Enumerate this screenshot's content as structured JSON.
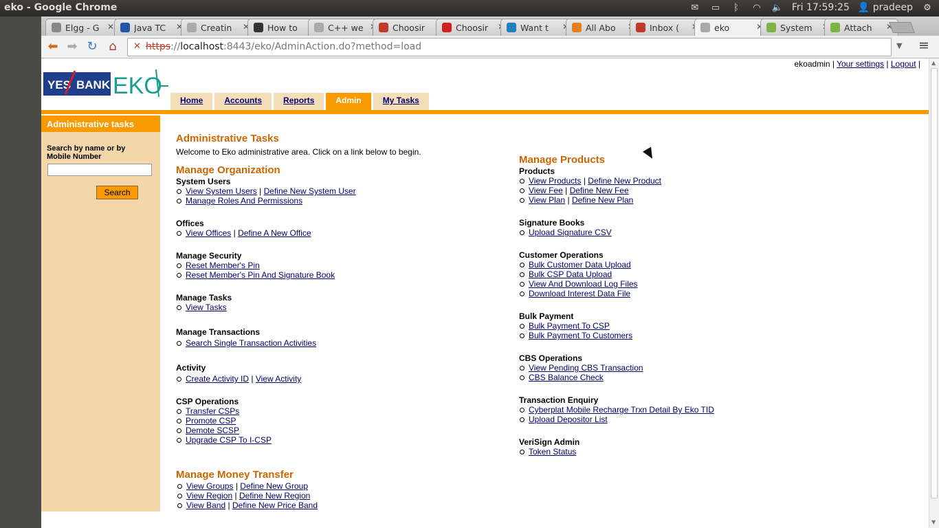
{
  "os": {
    "window_title": "eko - Google Chrome",
    "time": "Fri 17:59:25",
    "user": "pradeep"
  },
  "tabs": [
    {
      "label": "Elgg - G",
      "icon": "google-icon",
      "color": "#888888"
    },
    {
      "label": "Java TC",
      "icon": "grid-icon",
      "color": "#2255aa"
    },
    {
      "label": "Creatin",
      "icon": "page-icon",
      "color": "#aaaaaa"
    },
    {
      "label": "How to",
      "icon": "wordpress-icon",
      "color": "#333333"
    },
    {
      "label": "C++ we",
      "icon": "page-icon",
      "color": "#aaaaaa"
    },
    {
      "label": "Choosir",
      "icon": "sv-icon",
      "color": "#c0392b"
    },
    {
      "label": "Choosir",
      "icon": "red-circle-icon",
      "color": "#d41f1f"
    },
    {
      "label": "Want t",
      "icon": "drupal-icon",
      "color": "#1f7fc0"
    },
    {
      "label": "All Abo",
      "icon": "asterisk-icon",
      "color": "#e67e22"
    },
    {
      "label": "Inbox (",
      "icon": "gmail-icon",
      "color": "#c0392b"
    },
    {
      "label": "eko",
      "icon": "page-icon",
      "color": "#aaaaaa"
    },
    {
      "label": "System",
      "icon": "leaf-icon",
      "color": "#7cb342"
    },
    {
      "label": "Attach",
      "icon": "leaf-icon",
      "color": "#7cb342"
    }
  ],
  "omnibox": {
    "scheme": "https",
    "host": "localhost",
    "rest": ":8443/eko/AdminAction.do?method=load"
  },
  "header": {
    "username": "ekoadmin",
    "settings_link": "Your settings",
    "logout_link": "Logout",
    "logo_yes": "YES",
    "logo_bank": "BANK",
    "logo_eko": "EKO"
  },
  "nav": [
    {
      "label": "Home",
      "active": false
    },
    {
      "label": "Accounts",
      "active": false
    },
    {
      "label": "Reports",
      "active": false
    },
    {
      "label": "Admin",
      "active": true
    },
    {
      "label": "My Tasks",
      "active": false
    }
  ],
  "sidebar": {
    "title": "Administrative tasks",
    "search_label": "Search by name or by Mobile Number",
    "search_value": "",
    "search_button": "Search"
  },
  "main": {
    "title": "Administrative Tasks",
    "welcome": "Welcome to Eko administrative area. Click on a link below to begin.",
    "org_title": "Manage Organization",
    "products_title": "Manage Products",
    "money_title": "Manage Money Transfer",
    "left_sections": [
      {
        "label": "System Users",
        "items": [
          [
            "View System Users",
            "Define New System User"
          ],
          [
            "Manage Roles And Permissions"
          ]
        ]
      },
      {
        "label": "Offices",
        "items": [
          [
            "View Offices",
            "Define A New Office"
          ]
        ]
      },
      {
        "label": "Manage Security",
        "items": [
          [
            "Reset Member's Pin"
          ],
          [
            "Reset Member's Pin And Signature Book"
          ]
        ]
      },
      {
        "label": "Manage Tasks",
        "items": [
          [
            "View Tasks"
          ]
        ]
      },
      {
        "label": "Manage Transactions",
        "items": [
          [
            "Search Single Transaction Activities"
          ]
        ]
      },
      {
        "label": "Activity",
        "items": [
          [
            "Create Activity ID",
            "View Activity"
          ]
        ]
      },
      {
        "label": "CSP Operations",
        "items": [
          [
            "Transfer CSPs"
          ],
          [
            "Promote CSP"
          ],
          [
            "Demote SCSP"
          ],
          [
            "Upgrade CSP To I-CSP"
          ]
        ]
      }
    ],
    "money_items": [
      [
        "View Groups",
        "Define New Group"
      ],
      [
        "View Region",
        "Define New Region"
      ],
      [
        "View Band",
        "Define New Price Band"
      ]
    ],
    "right_sections": [
      {
        "label": "Products",
        "items": [
          [
            "View Products",
            "Define New Product"
          ],
          [
            "View Fee",
            "Define New Fee"
          ],
          [
            "View Plan",
            "Define New Plan"
          ]
        ]
      },
      {
        "label": "Signature Books",
        "items": [
          [
            "Upload Signature CSV"
          ]
        ]
      },
      {
        "label": "Customer Operations",
        "items": [
          [
            "Bulk Customer Data Upload"
          ],
          [
            "Bulk CSP Data Upload"
          ],
          [
            "View And Download Log Files"
          ],
          [
            "Download Interest Data File"
          ]
        ]
      },
      {
        "label": "Bulk Payment",
        "items": [
          [
            "Bulk Payment To CSP"
          ],
          [
            "Bulk Payment To Customers"
          ]
        ]
      },
      {
        "label": "CBS Operations",
        "items": [
          [
            "View Pending CBS Transaction"
          ],
          [
            "CBS Balance Check"
          ]
        ]
      },
      {
        "label": "Transaction Enquiry",
        "items": [
          [
            "Cyberplat Mobile Recharge Trxn Detail By Eko TID"
          ],
          [
            "Upload Depositor List"
          ]
        ]
      },
      {
        "label": "VeriSign Admin",
        "items": [
          [
            "Token Status"
          ]
        ]
      }
    ]
  },
  "colors": {
    "accent_orange": "#f99a00",
    "heading_orange": "#cc6600",
    "link_blue": "#00006b",
    "sidebar_bg": "#f4d6ab"
  }
}
